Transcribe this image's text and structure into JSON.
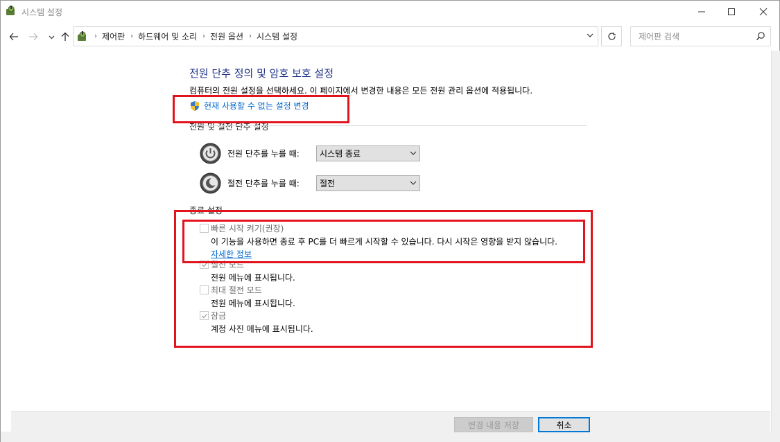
{
  "window": {
    "title": "시스템 설정"
  },
  "address_bar": {
    "breadcrumbs": [
      "제어판",
      "하드웨어 및 소리",
      "전원 옵션",
      "시스템 설정"
    ]
  },
  "search": {
    "placeholder": "제어판 검색"
  },
  "main": {
    "title": "전원 단추 정의 및 암호 보호 설정",
    "description": "컴퓨터의 전원 설정을 선택하세요. 이 페이지에서 변경한 내용은 모든 전원 관리 옵션에 적용됩니다.",
    "change_link": "현재 사용할 수 없는 설정 변경"
  },
  "power_buttons_section": {
    "label": "전원 및 절전 단추 설정",
    "rows": [
      {
        "label": "전원 단추를 누를 때:",
        "value": "시스템 종료",
        "icon": "power-button-icon"
      },
      {
        "label": "절전 단추를 누를 때:",
        "value": "절전",
        "icon": "sleep-button-icon"
      }
    ]
  },
  "shutdown_section": {
    "label": "종료 설정",
    "options": [
      {
        "title": "빠른 시작 켜기(권장)",
        "checked": false,
        "description": "이 기능을 사용하면 종료 후 PC를 더 빠르게 시작할 수 있습니다. 다시 시작은 영향을 받지 않습니다.",
        "link": "자세한 정보"
      },
      {
        "title": "절전 모드",
        "checked": true,
        "description": "전원 메뉴에 표시됩니다."
      },
      {
        "title": "최대 절전 모드",
        "checked": false,
        "description": "전원 메뉴에 표시됩니다."
      },
      {
        "title": "잠금",
        "checked": true,
        "description": "계정 사진 메뉴에 표시됩니다."
      }
    ]
  },
  "footer": {
    "save_label": "변경 내용 저장",
    "cancel_label": "취소"
  },
  "colors": {
    "title_blue": "#1e3287",
    "link_blue": "#0066cc",
    "highlight_red": "#e1141e"
  }
}
